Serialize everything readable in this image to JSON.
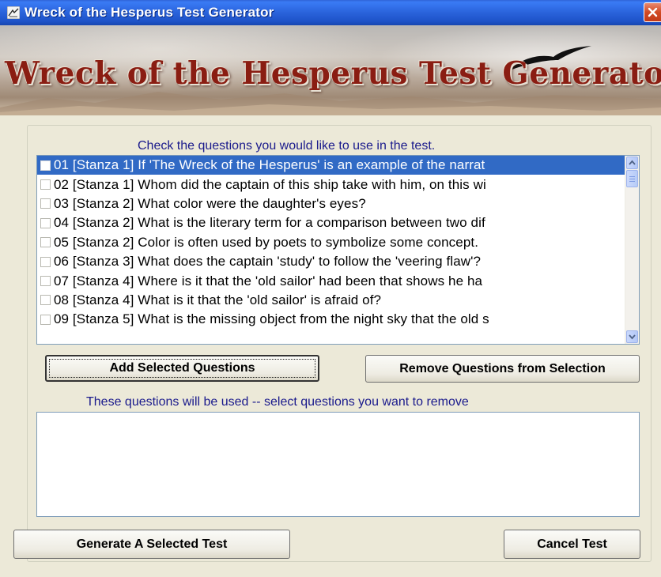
{
  "window": {
    "title": "Wreck of the Hesperus Test Generator",
    "icon": "quill-icon",
    "close_icon": "close-icon"
  },
  "banner": {
    "title": "Wreck of the Hesperus Test Generator",
    "title_color": "#8a1d12"
  },
  "questions": {
    "instruction": "Check the questions you would like to use in the test.",
    "items": [
      {
        "label": "01 [Stanza 1]  If 'The Wreck of the Hesperus' is an example of the narrat",
        "checked": false,
        "selected": true
      },
      {
        "label": "02 [Stanza 1]  Whom did the captain of this ship take with him, on this wi",
        "checked": false,
        "selected": false
      },
      {
        "label": "03 [Stanza 2]  What color were the daughter's eyes?",
        "checked": false,
        "selected": false
      },
      {
        "label": "04 [Stanza 2]  What is the literary term for a comparison between two dif",
        "checked": false,
        "selected": false
      },
      {
        "label": "05 [Stanza 2]  Color is often used by poets to symbolize some concept.",
        "checked": false,
        "selected": false
      },
      {
        "label": "06 [Stanza 3]  What does the captain 'study' to follow the 'veering flaw'?",
        "checked": false,
        "selected": false
      },
      {
        "label": "07 [Stanza 4]  Where is it that the 'old sailor' had been that shows he ha",
        "checked": false,
        "selected": false
      },
      {
        "label": "08 [Stanza 4]  What is it that the 'old sailor' is afraid of?",
        "checked": false,
        "selected": false
      },
      {
        "label": "09 [Stanza 5]  What is the missing object from the night sky that the old s",
        "checked": false,
        "selected": false
      }
    ]
  },
  "buttons": {
    "add": "Add Selected Questions",
    "remove": "Remove Questions from Selection",
    "generate": "Generate A Selected Test",
    "cancel": "Cancel Test"
  },
  "selection": {
    "instruction": "These questions will be used --  select questions you want to remove",
    "items": []
  },
  "colors": {
    "instruction_text": "#1a1a8c",
    "selection_highlight": "#316ac5"
  }
}
